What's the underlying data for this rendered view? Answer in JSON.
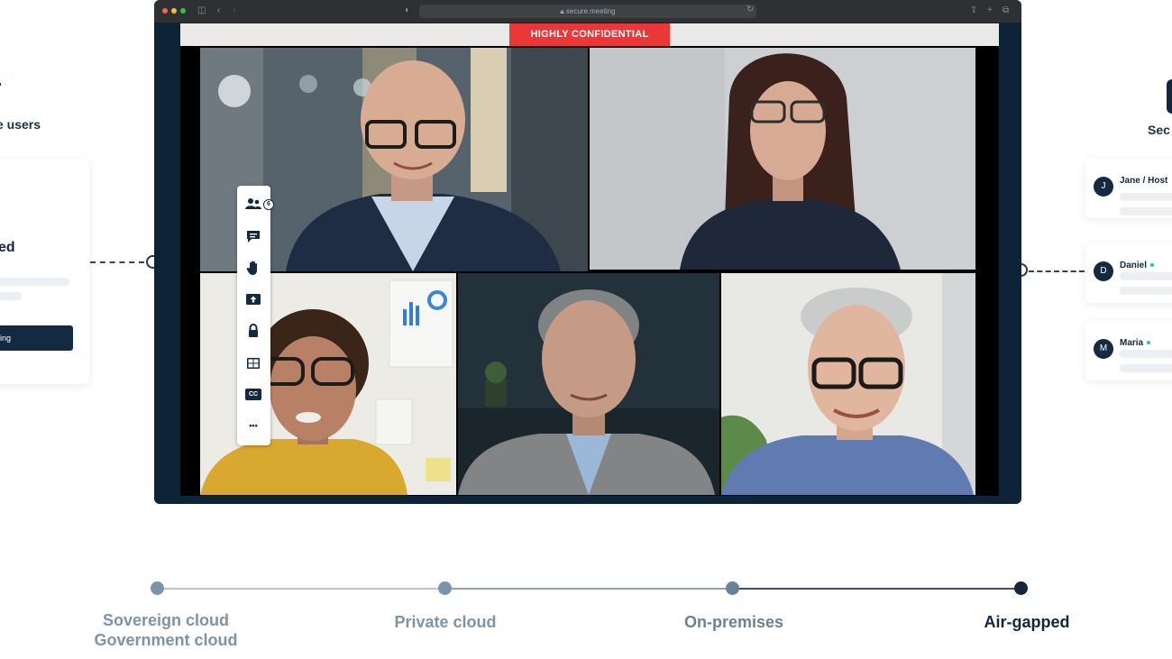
{
  "left_panel": {
    "title": "e users",
    "heading": "ed",
    "button_label": "ing"
  },
  "right_panel": {
    "title": "Sec",
    "participants": [
      {
        "initial": "J",
        "name": "Jane / Host",
        "online": false
      },
      {
        "initial": "D",
        "name": "Daniel",
        "online": true
      },
      {
        "initial": "M",
        "name": "Maria",
        "online": true
      }
    ]
  },
  "browser": {
    "url": "secure.meeting",
    "banner": "HIGHLY CONFIDENTIAL"
  },
  "meeting": {
    "participants_count": "6",
    "tools": [
      "participants-icon",
      "chat-icon",
      "raise-hand-icon",
      "share-screen-icon",
      "lock-icon",
      "layout-icon",
      "captions-icon",
      "more-icon"
    ],
    "captions_label": "CC",
    "more_label": "•••"
  },
  "deployment_timeline": {
    "stages": [
      {
        "label_lines": [
          "Sovereign cloud",
          "Government cloud"
        ],
        "active": false
      },
      {
        "label_lines": [
          "Private cloud"
        ],
        "active": false
      },
      {
        "label_lines": [
          "On-premises"
        ],
        "active": false
      },
      {
        "label_lines": [
          "Air-gapped"
        ],
        "active": true
      }
    ]
  },
  "colors": {
    "navy": "#132a42",
    "confidential_red": "#ea3838",
    "online_green": "#20c4a7",
    "timeline_inactive": "#7c94ab",
    "timeline_active": "#13263a"
  }
}
